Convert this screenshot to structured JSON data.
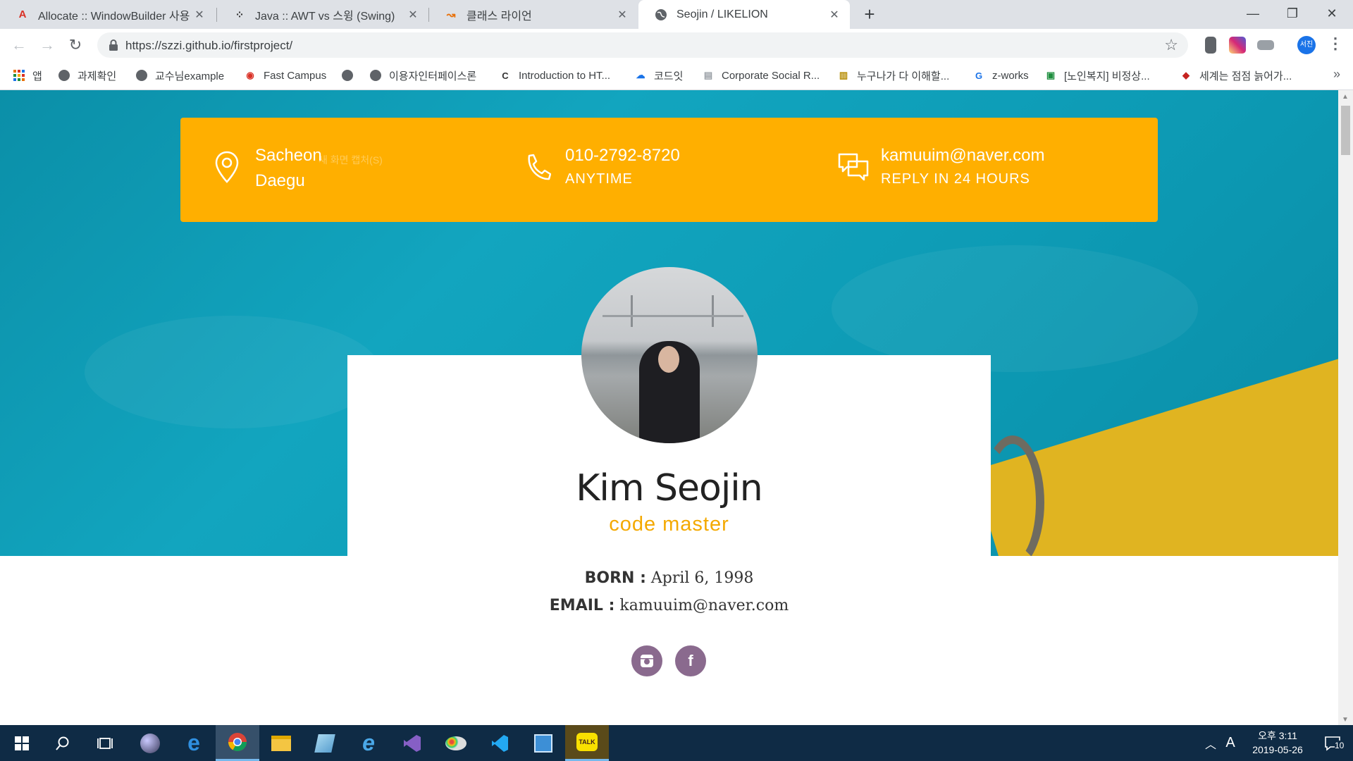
{
  "browser": {
    "tabs": [
      {
        "title": "Allocate :: WindowBuilder 사용",
        "favicon": "allocate-logo-icon",
        "active": false
      },
      {
        "title": "Java :: AWT vs 스윙 (Swing)",
        "favicon": "dots-logo-icon",
        "active": false
      },
      {
        "title": "클래스 라이언",
        "favicon": "classlion-logo-icon",
        "active": false
      },
      {
        "title": "Seojin / LIKELION",
        "favicon": "globe-icon",
        "active": true
      }
    ],
    "url": "https://szzi.github.io/firstproject/",
    "profile_initials": "서진",
    "bookmarks": [
      {
        "label": "앱",
        "icon": "apps-grid-icon"
      },
      {
        "label": "과제확인",
        "icon": "globe-icon"
      },
      {
        "label": "교수님example",
        "icon": "globe-icon"
      },
      {
        "label": "Fast Campus",
        "icon": "fastcampus-logo-icon"
      },
      {
        "label": "",
        "icon": "globe-icon"
      },
      {
        "label": "이용자인터페이스론",
        "icon": "globe-icon"
      },
      {
        "label": "Introduction to HT...",
        "icon": "c-logo-icon"
      },
      {
        "label": "코드잇",
        "icon": "codeit-logo-icon"
      },
      {
        "label": "Corporate Social R...",
        "icon": "doc-icon"
      },
      {
        "label": "누구나가 다 이해할...",
        "icon": "book-icon"
      },
      {
        "label": "z-works",
        "icon": "translate-icon"
      },
      {
        "label": "[노인복지] 비정상...",
        "icon": "naver-blog-icon"
      },
      {
        "label": "세계는 점점 늙어가...",
        "icon": "news-logo-icon"
      }
    ]
  },
  "page": {
    "contact": {
      "location_line1": "Sacheon",
      "location_line2": "Daegu",
      "faint_overlay": "새 화면 캡처(S)",
      "phone_line1": "010-2792-8720",
      "phone_line2": "ANYTIME",
      "email_line1": "kamuuim@naver.com",
      "email_line2": "REPLY IN 24 HOURS"
    },
    "profile": {
      "name": "Kim Seojin",
      "role": "code master",
      "born_label": "BORN :",
      "born_value": "April 6, 1998",
      "email_label": "EMAIL :",
      "email_value": "kamuuim@naver.com"
    },
    "social": [
      {
        "name": "instagram",
        "glyph": "◙"
      },
      {
        "name": "facebook",
        "glyph": "f"
      }
    ],
    "colors": {
      "accent": "#ffaf00",
      "hero": "#0d9bb5",
      "social": "#8a6a8e"
    }
  },
  "taskbar": {
    "clock_period": "오후 3:11",
    "clock_date": "2019-05-26",
    "ime": "A",
    "notifications": "10"
  }
}
